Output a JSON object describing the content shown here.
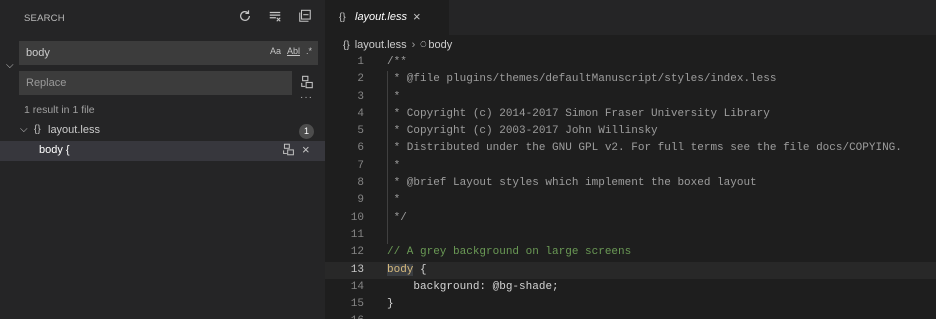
{
  "sidebar": {
    "title": "SEARCH",
    "actions": [
      {
        "icon": "refresh-icon"
      },
      {
        "icon": "clear-results-icon"
      },
      {
        "icon": "collapse-all-icon"
      }
    ],
    "search": {
      "value": "body",
      "opt_case": "Aa",
      "opt_word": "Abl",
      "opt_regex": ".*"
    },
    "replace": {
      "placeholder": "Replace"
    },
    "more": "···",
    "result_summary": "1 result in 1 file",
    "file": {
      "name": "layout.less",
      "icon": "{}",
      "count": "1"
    },
    "match": {
      "text": "body {"
    }
  },
  "editor": {
    "tab": {
      "icon": "{}",
      "name": "layout.less",
      "close": "×"
    },
    "breadcrumb": {
      "file_icon": "{}",
      "file": "layout.less",
      "separator": "›",
      "symbol_icon": "⁰ₑ",
      "symbol": "body"
    },
    "current_line": 13,
    "lines": [
      {
        "num": "1",
        "text": "/**"
      },
      {
        "num": "2",
        "text": " * @file plugins/themes/defaultManuscript/styles/index.less"
      },
      {
        "num": "3",
        "text": " *"
      },
      {
        "num": "4",
        "text": " * Copyright (c) 2014-2017 Simon Fraser University Library"
      },
      {
        "num": "5",
        "text": " * Copyright (c) 2003-2017 John Willinsky"
      },
      {
        "num": "6",
        "text": " * Distributed under the GNU GPL v2. For full terms see the file docs/COPYING."
      },
      {
        "num": "7",
        "text": " *"
      },
      {
        "num": "8",
        "text": " * @brief Layout styles which implement the boxed layout"
      },
      {
        "num": "9",
        "text": " *"
      },
      {
        "num": "10",
        "text": " */"
      },
      {
        "num": "11",
        "text": ""
      },
      {
        "num": "12",
        "text": "// A grey background on large screens"
      },
      {
        "num": "13",
        "text_sel": "body",
        "text_rest": " {"
      },
      {
        "num": "14",
        "text_prop": "    background:",
        "text_val": " @bg-shade;"
      },
      {
        "num": "15",
        "text": "}"
      },
      {
        "num": "16",
        "text": ""
      }
    ]
  },
  "colors": {
    "sidebar_bg": "#252526",
    "editor_bg": "#1e1e1e",
    "input_bg": "#3c3c3c",
    "selected_row_bg": "#37373d",
    "comment": "#6a9955"
  }
}
